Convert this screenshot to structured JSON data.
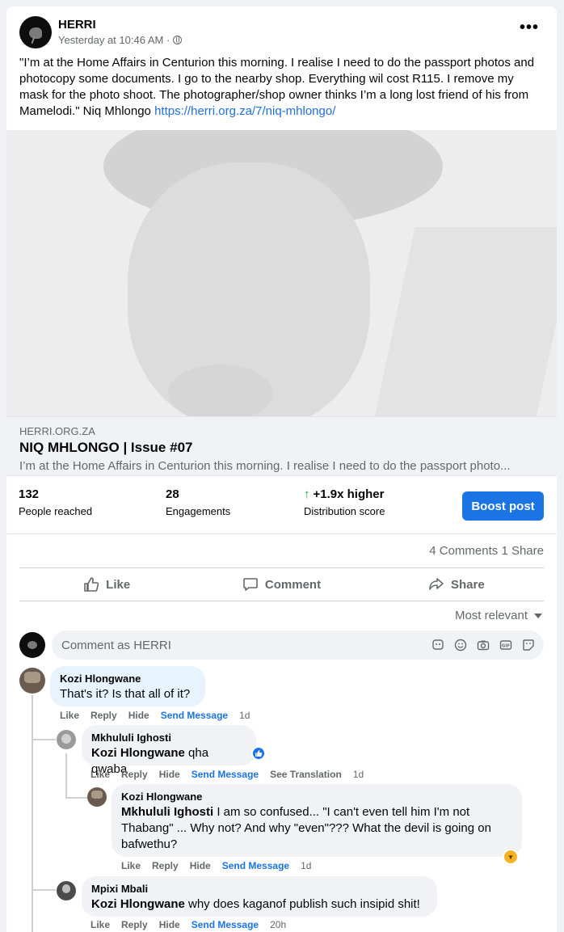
{
  "post": {
    "author": "HERRI",
    "timestamp": "Yesterday at 10:46 AM ·",
    "text": "\"I’m at the Home Affairs in Centurion this morning. I realise I need to do the passport photos and photocopy some documents. I go to the nearby shop. Everything wil cost R115. I remove my mask for the photo shoot. The photographer/shop owner thinks I’m a long lost friend of his from Mamelodi.\" Niq Mhlongo ",
    "link": "https://herri.org.za/7/niq-mhlongo/"
  },
  "link_preview": {
    "domain": "HERRI.ORG.ZA",
    "title": "NIQ MHLONGO | Issue #07",
    "description": "I’m at the Home Affairs in Centurion this morning. I realise I need to do the passport photo..."
  },
  "stats": {
    "reached_value": "132",
    "reached_label": "People reached",
    "engagements_value": "28",
    "engagements_label": "Engagements",
    "distribution_value": "+1.9x higher",
    "distribution_label": "Distribution score",
    "boost_label": "Boost post"
  },
  "counts": {
    "comments": "4 Comments",
    "shares": "1 Share"
  },
  "actions": {
    "like": "Like",
    "comment": "Comment",
    "share": "Share"
  },
  "sort_label": "Most relevant",
  "composer": {
    "placeholder": "Comment as HERRI"
  },
  "comments": [
    {
      "name": "Kozi Hlongwane",
      "tag": "",
      "text": "That's it? Is that all of it?",
      "actions": [
        "Like",
        "Reply",
        "Hide",
        "Send Message"
      ],
      "time": "1d"
    },
    {
      "name": "Mkhululi Ighosti",
      "tag": "Kozi Hlongwane",
      "text": " qha qwaba",
      "actions": [
        "Like",
        "Reply",
        "Hide",
        "Send Message",
        "See Translation"
      ],
      "time": "1d"
    },
    {
      "name": "Kozi Hlongwane",
      "tag": "Mkhululi Ighosti",
      "text": " I am so confused... \"I can't even tell him I'm not Thabang\" ... Why not? And why \"even\"??? What the devil is going on bafwethu?",
      "actions": [
        "Like",
        "Reply",
        "Hide",
        "Send Message"
      ],
      "time": "1d"
    },
    {
      "name": "Mpixi Mbali",
      "tag": "Kozi Hlongwane",
      "text": " why does kaganof publish such insipid shit!",
      "actions": [
        "Like",
        "Reply",
        "Hide",
        "Send Message"
      ],
      "time": "20h"
    }
  ],
  "colors": {
    "accent": "#1b74e4",
    "link": "#216fdb",
    "up": "#1e9e3b"
  }
}
